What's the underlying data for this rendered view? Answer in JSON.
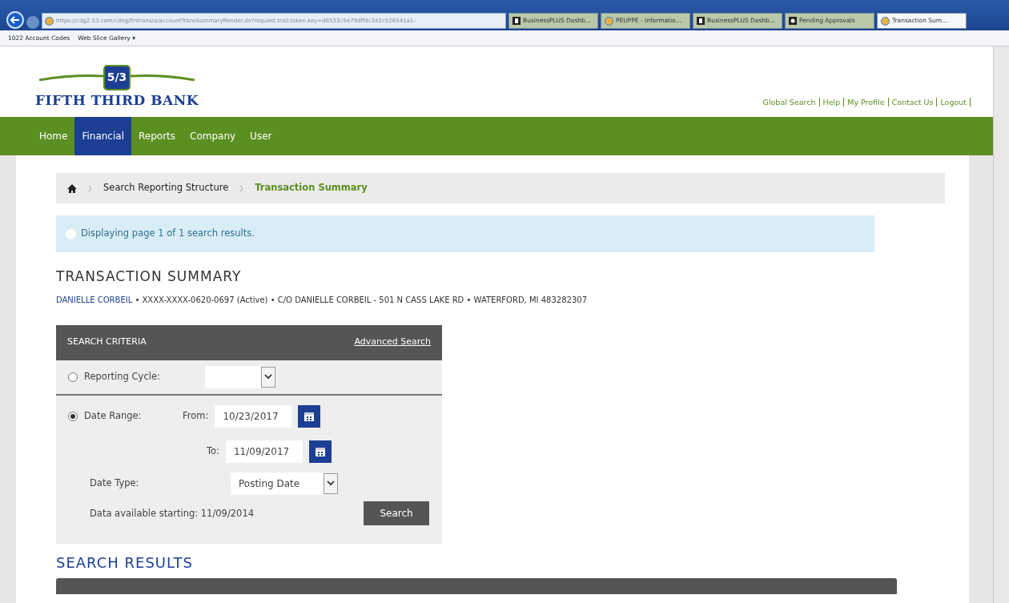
{
  "browser": {
    "address": "https://cdg2.53.com/cdng/fintrans/a/accountTransSummaryRender.do?request.trail.token.key=d6533c5e79dff4c342c526541a1-",
    "tabs": [
      {
        "label": "BusinessPLUS Dashb...",
        "selected": false,
        "kind": "s"
      },
      {
        "label": "PEUPPE - Informatio...",
        "selected": false,
        "kind": "globe"
      },
      {
        "label": "BusinessPLUS Dashb...",
        "selected": false,
        "kind": "s"
      },
      {
        "label": "Pending Approvals",
        "selected": false,
        "kind": "a"
      },
      {
        "label": "Transaction Sum...",
        "selected": true,
        "kind": "globe"
      }
    ],
    "favorites": [
      {
        "label": "1022 Account Codes"
      },
      {
        "label": "Web Slice Gallery ▾"
      }
    ]
  },
  "header": {
    "logo_text": "FIFTH THIRD BANK",
    "logo_mark": "5/3",
    "links": [
      "Global Search",
      "Help",
      "My Profile",
      "Contact Us",
      "Logout"
    ]
  },
  "nav": [
    {
      "label": "Home",
      "selected": false
    },
    {
      "label": "Financial",
      "selected": true
    },
    {
      "label": "Reports",
      "selected": false
    },
    {
      "label": "Company",
      "selected": false
    },
    {
      "label": "User",
      "selected": false
    }
  ],
  "breadcrumb": [
    "Search Reporting Structure",
    "Transaction Summary"
  ],
  "alert": "Displaying page 1 of 1 search results.",
  "title": "TRANSACTION SUMMARY",
  "account": {
    "name": "DANIELLE CORBEIL",
    "details": " • XXXX-XXXX-0620-0697 (Active) • C/O DANIELLE CORBEIL - 501 N CASS LAKE RD • WATERFORD, MI 483282307"
  },
  "search_criteria": {
    "title": "SEARCH CRITERIA",
    "advanced_link": "Advanced Search",
    "options": [
      {
        "label": "Reporting Cycle:",
        "selected": false
      },
      {
        "label": "Date Range:",
        "selected": true
      }
    ],
    "from_label": "From:",
    "from_value": "10/23/2017",
    "to_label": "To:",
    "to_value": "11/09/2017",
    "date_type_label": "Date Type:",
    "date_type_value": "Posting Date",
    "available": "Data available starting: 11/09/2014",
    "search_button": "Search"
  },
  "results_title": "SEARCH RESULTS"
}
